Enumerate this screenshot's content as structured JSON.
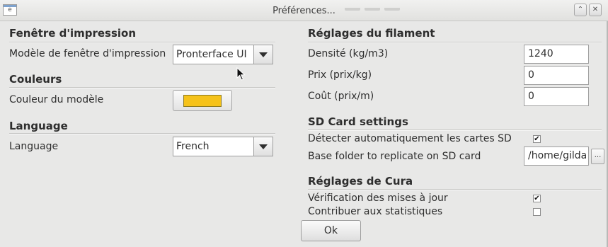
{
  "window": {
    "title": "Préférences...",
    "icon": "app-window-icon",
    "controls": [
      "maximize-icon",
      "close-icon"
    ],
    "maximize_glyph": "⌃",
    "close_glyph": "✕"
  },
  "print_window": {
    "section_title": "Fenêtre d'impression",
    "model_label": "Modèle de fenêtre d'impression",
    "model_value": "Pronterface UI"
  },
  "colors": {
    "section_title": "Couleurs",
    "model_color_label": "Couleur du modèle",
    "model_color_value": "#f5c21a"
  },
  "language": {
    "section_title": "Language",
    "label": "Language",
    "value": "French"
  },
  "filament": {
    "section_title": "Réglages du filament",
    "density_label": "Densité (kg/m3)",
    "density_value": "1240",
    "price_label": "Prix (prix/kg)",
    "price_value": "0",
    "cost_label": "Coût (prix/m)",
    "cost_value": "0"
  },
  "sd_card": {
    "section_title": "SD Card settings",
    "autodetect_label": "Détecter automatiquement les cartes SD",
    "autodetect_checked": true,
    "base_folder_label": "Base folder to replicate on SD card",
    "base_folder_value": "/home/gilda",
    "browse_label": "..."
  },
  "cura": {
    "section_title": "Réglages de Cura",
    "check_updates_label": "Vérification des mises à jour",
    "check_updates_checked": true,
    "stats_label": "Contribuer aux statistiques",
    "stats_checked": false
  },
  "ok_label": "Ok",
  "check_glyph": "✔",
  "icons": {
    "dropdown": "chevron-down-icon",
    "cursor": "mouse-pointer-icon"
  }
}
